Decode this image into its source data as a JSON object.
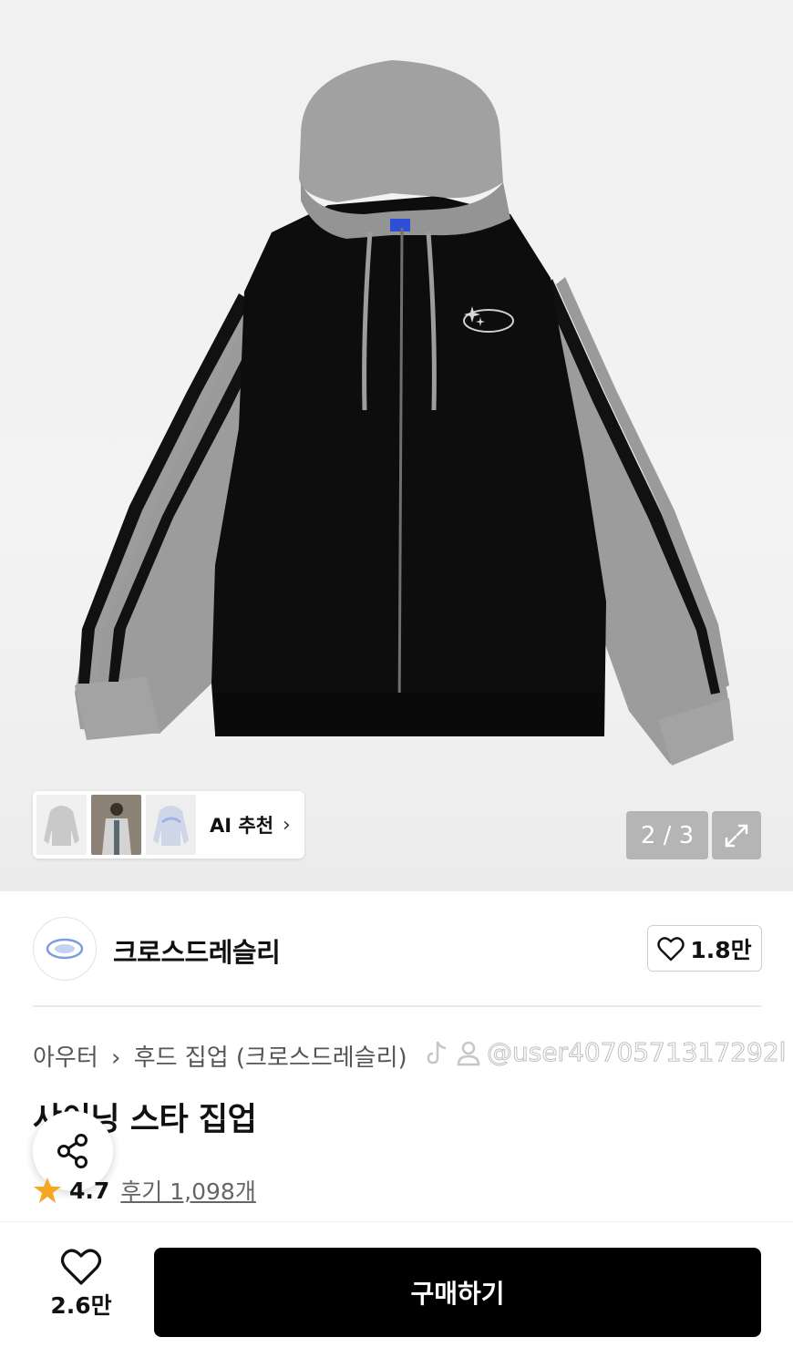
{
  "gallery": {
    "counter": "2 / 3",
    "thumbnails": [
      "thumbnail-1",
      "thumbnail-2",
      "thumbnail-3"
    ],
    "ai_label": "AI 추천",
    "ai_chevron": "›",
    "expand_icon": "expand-icon"
  },
  "brand": {
    "name": "크로스드레슬리",
    "likes": "1.8만",
    "logo_icon": "brand-logo-icon",
    "heart_icon": "heart-icon"
  },
  "breadcrumb": {
    "items": [
      "아우터",
      "후드 집업 (크로스드레슬리)"
    ],
    "separator": "›"
  },
  "watermark": {
    "text": "@user4070571317292l",
    "icons": [
      "tiktok-icon",
      "user-icon"
    ]
  },
  "product": {
    "title": "샤이닝 스타 집업",
    "rating": "4.7",
    "reviews": "후기 1,098개",
    "star_color": "#f5a623"
  },
  "share": {
    "icon": "share-icon"
  },
  "bottom": {
    "wish_count": "2.6만",
    "buy_label": "구매하기",
    "buy_color": "#000000"
  }
}
